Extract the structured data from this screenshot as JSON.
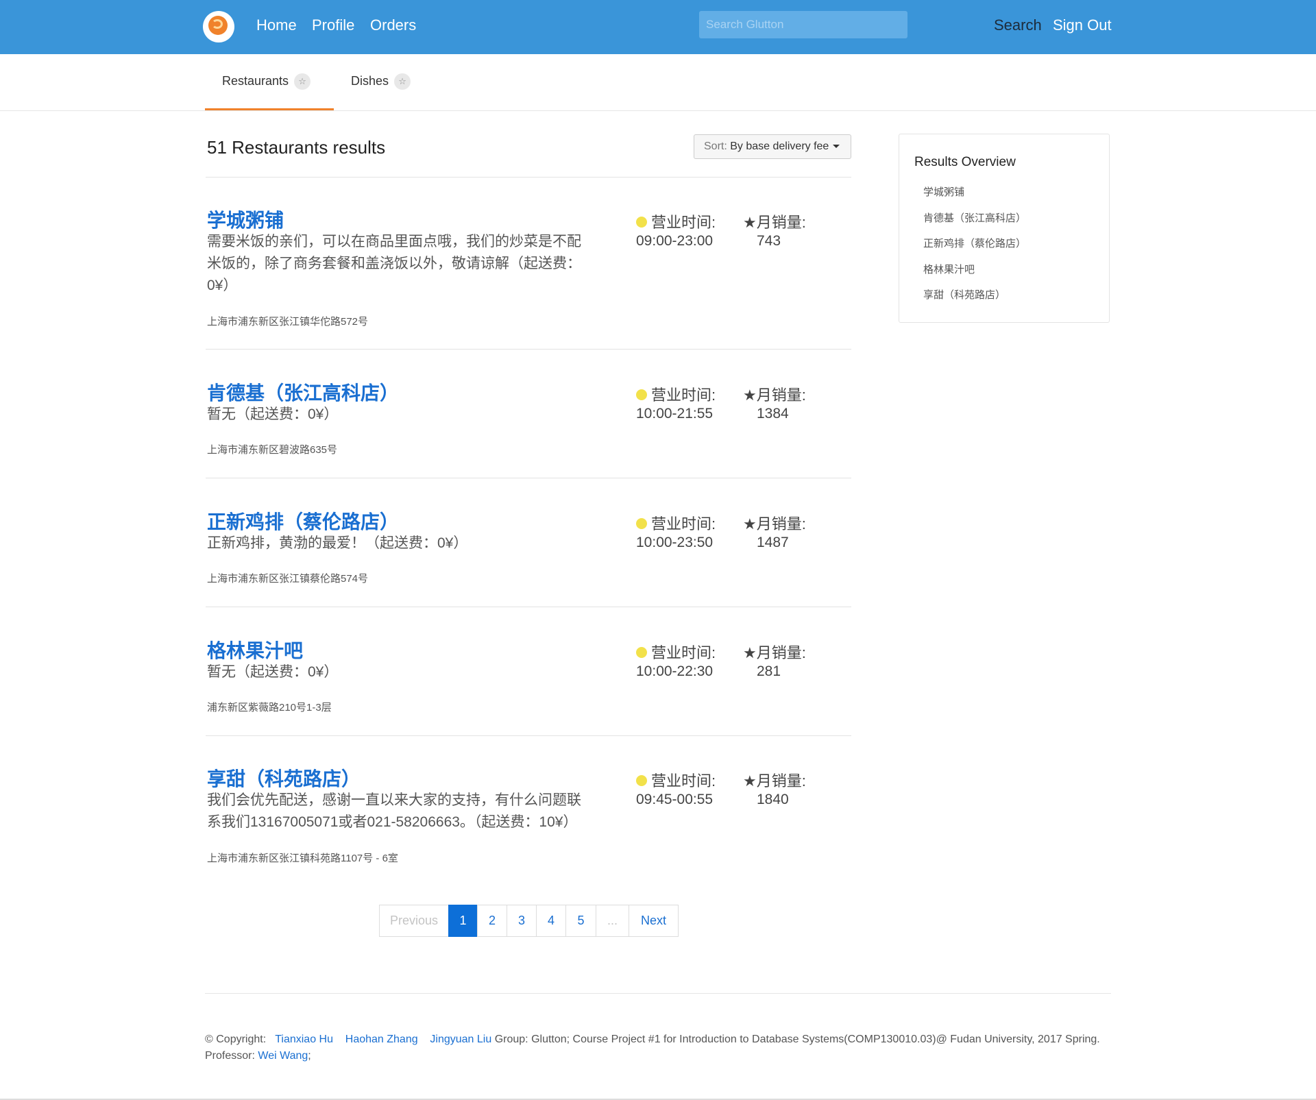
{
  "navbar": {
    "links": [
      "Home",
      "Profile",
      "Orders"
    ],
    "search_placeholder": "Search Glutton",
    "search_label": "Search",
    "signout_label": "Sign Out"
  },
  "tabs": [
    {
      "label": "Restaurants",
      "active": true
    },
    {
      "label": "Dishes",
      "active": false
    }
  ],
  "results": {
    "title": "51 Restaurants results",
    "sort_label": "Sort:",
    "sort_value": "By base delivery fee"
  },
  "labels": {
    "hours": "营业时间:",
    "sales": "★月销量:"
  },
  "restaurants": [
    {
      "name": "学城粥铺",
      "desc": "需要米饭的亲们，可以在商品里面点哦，我们的炒菜是不配米饭的，除了商务套餐和盖浇饭以外，敬请谅解（起送费：0¥）",
      "address": "上海市浦东新区张江镇华佗路572号",
      "hours": "09:00-23:00",
      "sales": "743"
    },
    {
      "name": "肯德基（张江高科店）",
      "desc": "暂无（起送费：0¥）",
      "address": "上海市浦东新区碧波路635号",
      "hours": "10:00-21:55",
      "sales": "1384"
    },
    {
      "name": "正新鸡排（蔡伦路店）",
      "desc": "正新鸡排，黄渤的最爱！（起送费：0¥）",
      "address": "上海市浦东新区张江镇蔡伦路574号",
      "hours": "10:00-23:50",
      "sales": "1487"
    },
    {
      "name": "格林果汁吧",
      "desc": "暂无（起送费：0¥）",
      "address": "浦东新区紫薇路210号1-3层",
      "hours": "10:00-22:30",
      "sales": "281"
    },
    {
      "name": "享甜（科苑路店）",
      "desc": "我们会优先配送，感谢一直以来大家的支持，有什么问题联系我们13167005071或者021-58206663。（起送费：10¥）",
      "address": "上海市浦东新区张江镇科苑路1107号 - 6室",
      "hours": "09:45-00:55",
      "sales": "1840"
    }
  ],
  "overview": {
    "title": "Results Overview",
    "items": [
      "学城粥铺",
      "肯德基（张江高科店）",
      "正新鸡排（蔡伦路店）",
      "格林果汁吧",
      "享甜（科苑路店）"
    ]
  },
  "pagination": {
    "previous": "Previous",
    "pages": [
      "1",
      "2",
      "3",
      "4",
      "5"
    ],
    "ellipsis": "...",
    "next": "Next",
    "current": "1"
  },
  "footer": {
    "copyright": "© Copyright:",
    "authors": [
      "Tianxiao Hu",
      "Haohan Zhang",
      "Jingyuan Liu"
    ],
    "text": "Group: Glutton; Course Project #1 for Introduction to Database Systems(COMP130010.03)@ Fudan University, 2017 Spring.",
    "professor_label": "Professor:",
    "professor": "Wei Wang",
    "professor_suffix": ";"
  },
  "colors": {
    "navbar": "#3a95d9",
    "accent": "#f0822b",
    "link": "#1a6fd1",
    "active_page": "#0d6fd8",
    "open_dot": "#f2e14a"
  },
  "icons": [
    "logo-icon",
    "star-icon",
    "caret-down-icon",
    "status-dot-icon"
  ]
}
